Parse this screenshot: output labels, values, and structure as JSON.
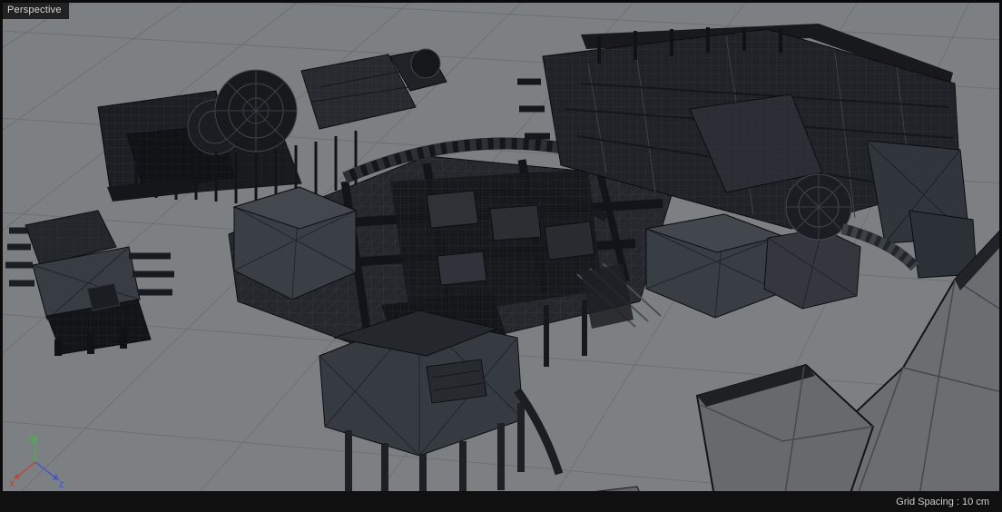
{
  "viewport": {
    "camera_label": "Perspective",
    "grid_spacing_label": "Grid Spacing : 10 cm",
    "axis_gizmo": {
      "x": {
        "label": "X",
        "color": "#b84b3e"
      },
      "y": {
        "label": "Y",
        "color": "#49b04c"
      },
      "z": {
        "label": "Z",
        "color": "#4a57c8"
      }
    },
    "colors": {
      "frame": "#0b0b0b",
      "background": "#7d8083",
      "grid_line": "#6d7073",
      "status_bar_bg": "#101010",
      "label_bg": "#1a1a1a",
      "text": "#d6d6d6",
      "mesh_dark": "#15181b",
      "mesh_mid": "#2a2e34",
      "mesh_panel": "#393e44",
      "mesh_edge_light": "#454a50",
      "terrain_flat": "#6b6e71"
    }
  }
}
